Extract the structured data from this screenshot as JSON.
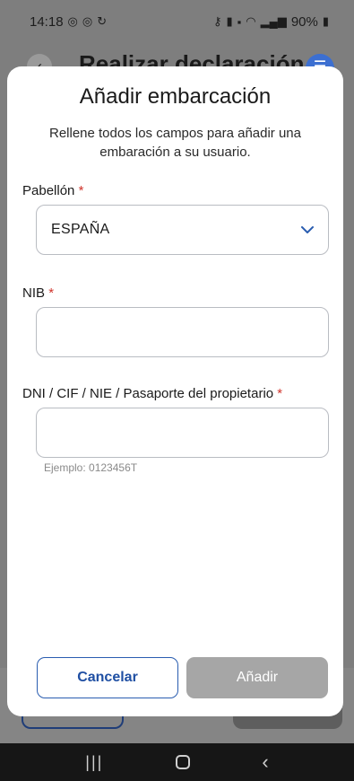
{
  "status_bar": {
    "time": "14:18",
    "left_icons": [
      "whatsapp-icon",
      "whatsapp-icon",
      "sync-icon"
    ],
    "right_icons": [
      "key-icon",
      "battery-saver-icon",
      "sim-icon",
      "wifi-icon",
      "signal-icon"
    ],
    "battery": "90%"
  },
  "background_page": {
    "title": "Realizar declaración",
    "back_icon": "chevron-left-icon",
    "menu_icon": "menu-icon"
  },
  "modal": {
    "title": "Añadir embarcación",
    "subtitle": "Rellene todos los campos para añadir una embaración a su usuario.",
    "required_mark": "*",
    "fields": {
      "pabellon": {
        "label": "Pabellón",
        "value": "ESPAÑA"
      },
      "nib": {
        "label": "NIB",
        "value": ""
      },
      "dni": {
        "label": "DNI / CIF / NIE / Pasaporte del propietario",
        "value": "",
        "helper": "Ejemplo: 0123456T"
      }
    },
    "buttons": {
      "cancel": "Cancelar",
      "add": "Añadir"
    }
  },
  "nav_bar": {
    "recent": "|||",
    "back": "‹"
  },
  "colors": {
    "accent": "#2a5db0",
    "required": "#d0342c",
    "disabled": "#a6a6a6"
  }
}
